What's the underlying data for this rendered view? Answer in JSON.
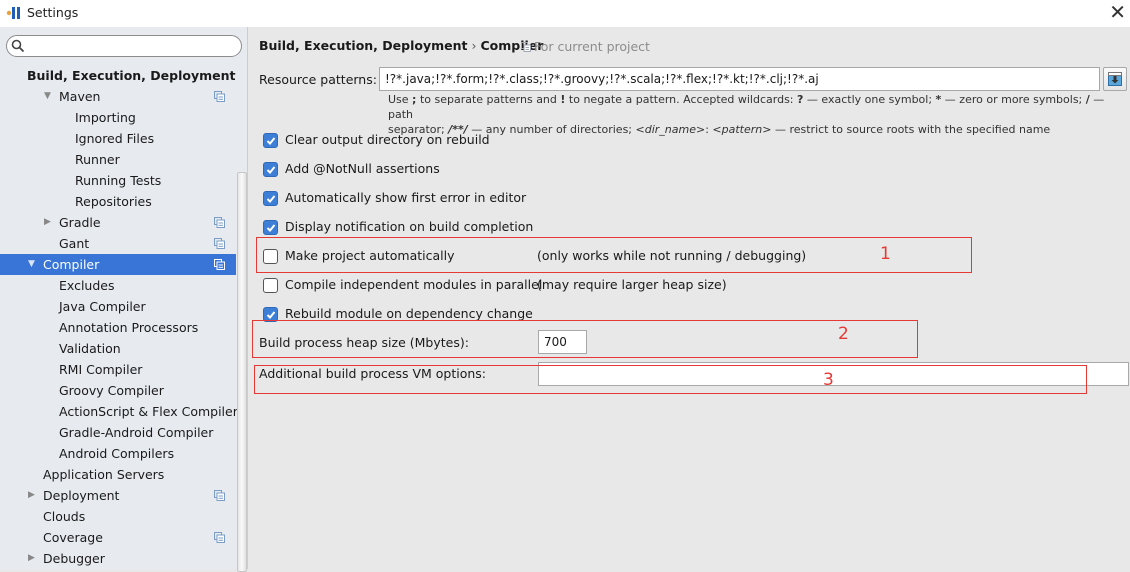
{
  "window": {
    "title": "Settings",
    "close_icon": "close-icon",
    "app_icon": "intellij-icon"
  },
  "sidebar": {
    "search_placeholder": "",
    "items": [
      {
        "label": "Build, Execution, Deployment",
        "level": 0,
        "bold": true
      },
      {
        "label": "Maven",
        "level": 1,
        "expanded": true,
        "project_icon": true
      },
      {
        "label": "Importing",
        "level": 2
      },
      {
        "label": "Ignored Files",
        "level": 2
      },
      {
        "label": "Runner",
        "level": 2
      },
      {
        "label": "Running Tests",
        "level": 2
      },
      {
        "label": "Repositories",
        "level": 2
      },
      {
        "label": "Gradle",
        "level": 1,
        "collapsed": true,
        "project_icon": true
      },
      {
        "label": "Gant",
        "level": 1,
        "project_icon": true
      },
      {
        "label": "Compiler",
        "level": 0,
        "expanded": true,
        "selected": true,
        "project_icon": true
      },
      {
        "label": "Excludes",
        "level": 1
      },
      {
        "label": "Java Compiler",
        "level": 1
      },
      {
        "label": "Annotation Processors",
        "level": 1
      },
      {
        "label": "Validation",
        "level": 1
      },
      {
        "label": "RMI Compiler",
        "level": 1
      },
      {
        "label": "Groovy Compiler",
        "level": 1
      },
      {
        "label": "ActionScript & Flex Compiler",
        "level": 1
      },
      {
        "label": "Gradle-Android Compiler",
        "level": 1
      },
      {
        "label": "Android Compilers",
        "level": 1
      },
      {
        "label": "Application Servers",
        "level": 0
      },
      {
        "label": "Deployment",
        "level": 0,
        "collapsed": true,
        "project_icon": true
      },
      {
        "label": "Clouds",
        "level": 0
      },
      {
        "label": "Coverage",
        "level": 0,
        "project_icon": true
      },
      {
        "label": "Debugger",
        "level": 0,
        "collapsed": true
      }
    ]
  },
  "main": {
    "breadcrumb": {
      "parent": "Build, Execution, Deployment",
      "separator": "›",
      "current": "Compiler"
    },
    "scope_label": "For current project",
    "resource_patterns": {
      "label": "Resource patterns:",
      "value": "!?*.java;!?*.form;!?*.class;!?*.groovy;!?*.scala;!?*.flex;!?*.kt;!?*.clj;!?*.aj"
    },
    "help": {
      "line1_a": "Use ",
      "line1_b": ";",
      "line1_c": " to separate patterns and ",
      "line1_d": "!",
      "line1_e": " to negate a pattern. Accepted wildcards: ",
      "line1_f": "?",
      "line1_g": " — exactly one symbol; ",
      "line1_h": "*",
      "line1_i": " — zero or more symbols; ",
      "line1_j": "/",
      "line1_k": " — path",
      "line2_a": "separator; ",
      "line2_b": "/**/",
      "line2_c": " — any number of directories;  ",
      "line2_d": "<dir_name>",
      "line2_e": ": ",
      "line2_f": "<pattern>",
      "line2_g": " — restrict to source roots with the specified name"
    },
    "checkboxes": [
      {
        "label": "Clear output directory on rebuild",
        "checked": true,
        "note": ""
      },
      {
        "label": "Add @NotNull assertions",
        "checked": true,
        "note": ""
      },
      {
        "label": "Automatically show first error in editor",
        "checked": true,
        "note": ""
      },
      {
        "label": "Display notification on build completion",
        "checked": true,
        "note": ""
      },
      {
        "label": "Make project automatically",
        "checked": false,
        "note": "(only works while not running / debugging)"
      },
      {
        "label": "Compile independent modules in parallel",
        "checked": false,
        "note": "(may require larger heap size)"
      },
      {
        "label": "Rebuild module on dependency change",
        "checked": true,
        "note": ""
      }
    ],
    "heap": {
      "label": "Build process heap size (Mbytes):",
      "value": "700"
    },
    "vm_options": {
      "label": "Additional build process VM options:",
      "value": ""
    },
    "annotations": [
      "1",
      "2",
      "3"
    ],
    "colors": {
      "accent": "#3875d7",
      "annotation": "#e53935",
      "checkbox": "#3d7fd6"
    }
  }
}
